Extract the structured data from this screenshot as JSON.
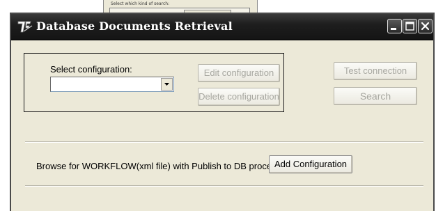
{
  "background_window": {
    "hint_text": "Select which kind of search:"
  },
  "window": {
    "title": "Database Documents Retrieval",
    "icon": "app-logo-icon",
    "controls": [
      "minimize-icon",
      "maximize-icon",
      "close-icon"
    ]
  },
  "config": {
    "label": "Select configuration:",
    "selected_value": "",
    "edit_label": "Edit configuration",
    "delete_label": "Delete configuration"
  },
  "actions": {
    "test_label": "Test connection",
    "search_label": "Search"
  },
  "browse": {
    "label": "Browse for WORKFLOW(xml file) with Publish to DB process:",
    "add_label": "Add Configuration"
  },
  "colors": {
    "titlebar": "#1e1e1e",
    "window_bg": "#ece9d8",
    "disabled_text": "#a7a7a0"
  }
}
